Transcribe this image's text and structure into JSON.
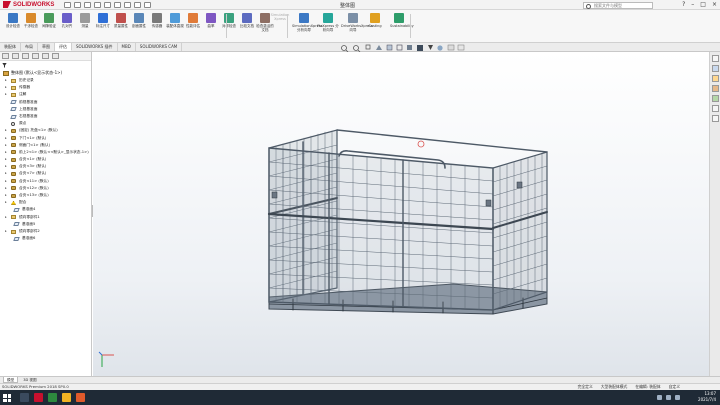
{
  "app": {
    "logo_text": "SOLIDWORKS",
    "document_title": "整体图",
    "search_placeholder": "搜索文件与模型"
  },
  "ribbon": {
    "buttons": [
      "设计检查",
      "干涉检查",
      "间隙验证",
      "孔对齐",
      "测量",
      "标注尺寸",
      "质量属性",
      "剖面属性",
      "传感器",
      "装配体直观",
      "性能评估",
      "曲率",
      "对称检查",
      "比较文档",
      "检查激活的文档",
      "SimulationXpress 分析向导",
      "FloXpress 分析向导",
      "DriveWorksXpress 向导",
      "Costing",
      "Sustainability"
    ],
    "disabled_label": "Simulation Xpress"
  },
  "cm_tabs": [
    "装配体",
    "布局",
    "草图",
    "评估",
    "SOLIDWORKS 插件",
    "MBD",
    "SOLIDWORKS CAM"
  ],
  "cm_active": "评估",
  "tree": {
    "root_label": "整体图  (默认<显示状态-1>)",
    "items": [
      {
        "label": "历史记录",
        "icon": "history-icon",
        "kind": "folder"
      },
      {
        "label": "传感器",
        "icon": "sensor-icon",
        "kind": "folder"
      },
      {
        "label": "注解",
        "icon": "annotation-icon",
        "kind": "folder"
      },
      {
        "label": "前视基准面",
        "icon": "plane-icon",
        "kind": "plane"
      },
      {
        "label": "上视基准面",
        "icon": "plane-icon",
        "kind": "plane"
      },
      {
        "label": "右视基准面",
        "icon": "plane-icon",
        "kind": "plane"
      },
      {
        "label": "原点",
        "icon": "origin-icon",
        "kind": "origin"
      },
      {
        "label": "(固定) 托盘<1> (默认)",
        "icon": "part-icon",
        "kind": "part"
      },
      {
        "label": "下门<1> (默认)",
        "icon": "part-icon",
        "kind": "part"
      },
      {
        "label": "侧面门<1> (默认)",
        "icon": "part-icon",
        "kind": "part"
      },
      {
        "label": "前上2<1> (默认<<默认>_显示状态-1>)",
        "icon": "part-icon",
        "kind": "part"
      },
      {
        "label": "合页<1> (默认)",
        "icon": "part-icon",
        "kind": "part"
      },
      {
        "label": "合页<3> (默认)",
        "icon": "part-icon",
        "kind": "part"
      },
      {
        "label": "合页<7> (默认)",
        "icon": "part-icon",
        "kind": "part"
      },
      {
        "label": "合页<11> (默认)",
        "icon": "part-icon",
        "kind": "part"
      },
      {
        "label": "合页<12> (默认)",
        "icon": "part-icon",
        "kind": "part"
      },
      {
        "label": "合页<13> (默认)",
        "icon": "part-icon",
        "kind": "part"
      },
      {
        "label": "配合",
        "icon": "mates-icon",
        "kind": "warn"
      },
      {
        "label": "基准面4",
        "icon": "plane-icon",
        "kind": "plane",
        "sub": true
      },
      {
        "label": "镜向零部件1",
        "icon": "mirror-icon",
        "kind": "folder"
      },
      {
        "label": "基准面5",
        "icon": "plane-icon",
        "kind": "plane",
        "sub": true
      },
      {
        "label": "镜向零部件2",
        "icon": "mirror-icon",
        "kind": "folder"
      },
      {
        "label": "基准面6",
        "icon": "plane-icon",
        "kind": "plane",
        "sub": true
      }
    ]
  },
  "sheet_tabs": [
    "模型",
    "3D 视图"
  ],
  "status": {
    "left": "SOLIDWORKS Premium 2018 SP0.0",
    "items": [
      "完全定义",
      "大型装配体模式",
      "在编辑: 装配体",
      "自定义"
    ]
  },
  "clock": {
    "time": "13:07",
    "date": "2021/7/4"
  }
}
